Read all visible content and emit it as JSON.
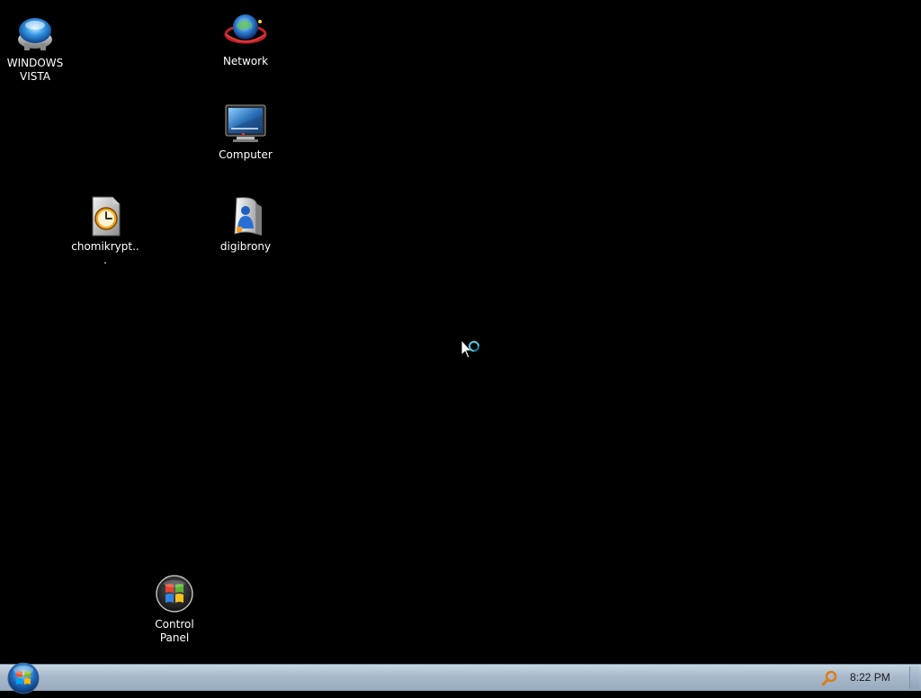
{
  "desktop": {
    "background_color": "#000000",
    "icons": [
      {
        "id": "vista",
        "label": "WINDOWS VISTA",
        "icon": "vista-orb-icon"
      },
      {
        "id": "network",
        "label": "Network",
        "icon": "network-globe-icon"
      },
      {
        "id": "computer",
        "label": "Computer",
        "icon": "computer-monitor-icon"
      },
      {
        "id": "chomikrypt",
        "label": "chomikrypt...",
        "icon": "clock-document-icon"
      },
      {
        "id": "digibrony",
        "label": "digibrony",
        "icon": "user-folder-icon"
      },
      {
        "id": "control_panel",
        "label": "Control Panel",
        "icon": "control-panel-icon"
      }
    ]
  },
  "taskbar": {
    "start_button": {
      "icon": "windows-start-orb-icon"
    },
    "tray": {
      "search_icon": "search-icon",
      "clock": "8:22 PM"
    },
    "show_desktop": {
      "icon": "show-desktop-icon"
    }
  },
  "cursor": {
    "icon": "busy-cursor-icon"
  }
}
